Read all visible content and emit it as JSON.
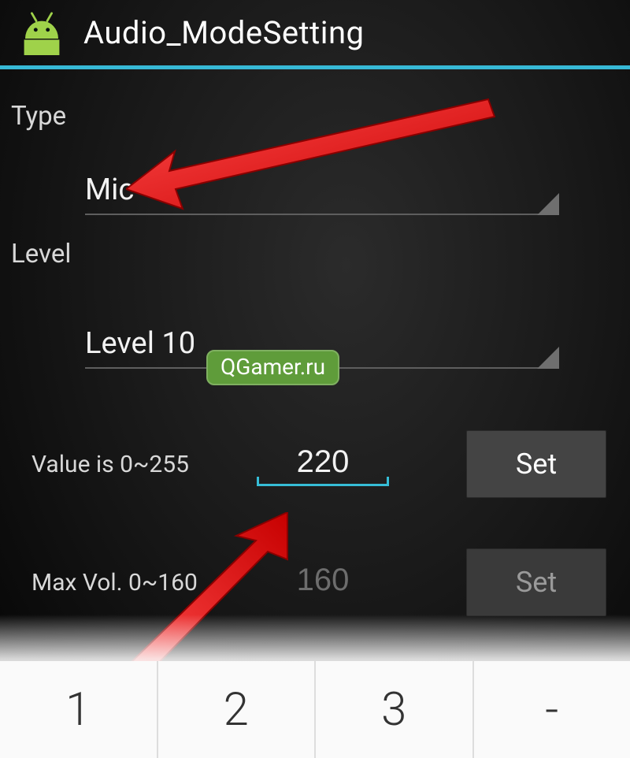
{
  "header": {
    "title": "Audio_ModeSetting"
  },
  "type_section": {
    "label": "Type",
    "selected": "Mic"
  },
  "level_section": {
    "label": "Level",
    "selected": "Level 10"
  },
  "value_row": {
    "label": "Value is 0~255",
    "value": "220",
    "button": "Set"
  },
  "maxvol_row": {
    "label": "Max Vol. 0~160",
    "value": "160",
    "button": "Set"
  },
  "keyboard": {
    "keys": [
      "1",
      "2",
      "3",
      "-"
    ]
  },
  "watermark": "QGamer.ru"
}
